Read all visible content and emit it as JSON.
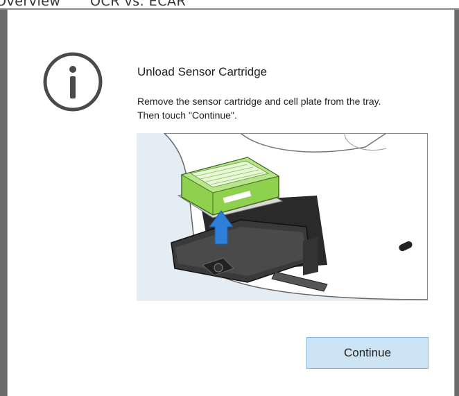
{
  "background": {
    "tabs": [
      "Overview",
      "OCR vs. ECAR"
    ]
  },
  "dialog": {
    "icon": "info-icon",
    "title": "Unload Sensor Cartridge",
    "message_lines": [
      "Remove the sensor cartridge and cell plate from the tray.",
      "Then touch \"Continue\"."
    ],
    "illustration": {
      "description_icon": "instrument-tray-illustration",
      "arrow_icon": "up-arrow-icon"
    },
    "continue_label": "Continue"
  },
  "colors": {
    "accent_button_bg": "#cde4f5",
    "accent_button_border": "#7fb4dd",
    "cartridge_green": "#8fd14f",
    "arrow_blue": "#2f7fd8",
    "illustration_bg": "#e3edf3"
  }
}
